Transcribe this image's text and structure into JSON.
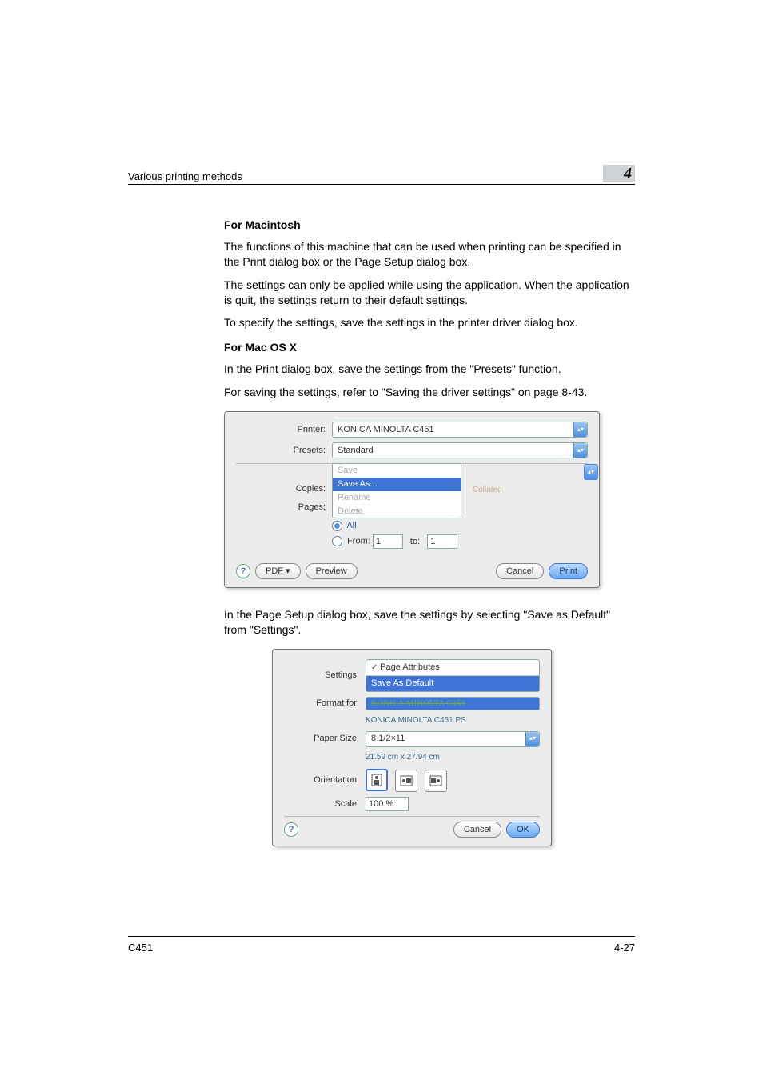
{
  "header": {
    "title": "Various printing methods",
    "chapter": "4"
  },
  "sections": {
    "mac_heading": "For Macintosh",
    "mac_p1": "The functions of this machine that can be used when printing can be specified in the Print dialog box or the Page Setup dialog box.",
    "mac_p2": "The settings can only be applied while using the application. When the application is quit, the settings return to their default settings.",
    "mac_p3": "To specify the settings, save the settings in the printer driver dialog box.",
    "osx_heading": "For Mac OS X",
    "osx_p1": "In the Print dialog box, save the settings from the \"Presets\" function.",
    "osx_p2": "For saving the settings, refer to \"Saving the driver settings\" on page 8-43.",
    "after_fig1": "In the Page Setup dialog box, save the settings by selecting \"Save as Default\" from \"Settings\"."
  },
  "fig1": {
    "printer_label": "Printer:",
    "printer_value": "KONICA MINOLTA C451",
    "presets_label": "Presets:",
    "presets_value": "Standard",
    "menu": {
      "save": "Save",
      "save_as": "Save As...",
      "rename": "Rename",
      "delete": "Delete"
    },
    "copies_label": "Copies:",
    "collated": "Collated",
    "pages_label": "Pages:",
    "all": "All",
    "from_label": "From:",
    "from_val": "1",
    "to_label": "to:",
    "to_val": "1",
    "help": "?",
    "pdf": "PDF ▾",
    "preview": "Preview",
    "cancel": "Cancel",
    "print": "Print"
  },
  "fig2": {
    "settings_label": "Settings:",
    "page_attributes": "Page Attributes",
    "save_as_default": "Save As Default",
    "format_for_label": "Format for:",
    "format_strike": "KONICA MINOLTA C451",
    "format_sub": "KONICA MINOLTA C451 PS",
    "paper_size_label": "Paper Size:",
    "paper_size_value": "8 1/2×11",
    "paper_dim": "21.59 cm x 27.94 cm",
    "orientation_label": "Orientation:",
    "scale_label": "Scale:",
    "scale_value": "100 %",
    "help": "?",
    "cancel": "Cancel",
    "ok": "OK"
  },
  "footer": {
    "model": "C451",
    "page": "4-27"
  }
}
